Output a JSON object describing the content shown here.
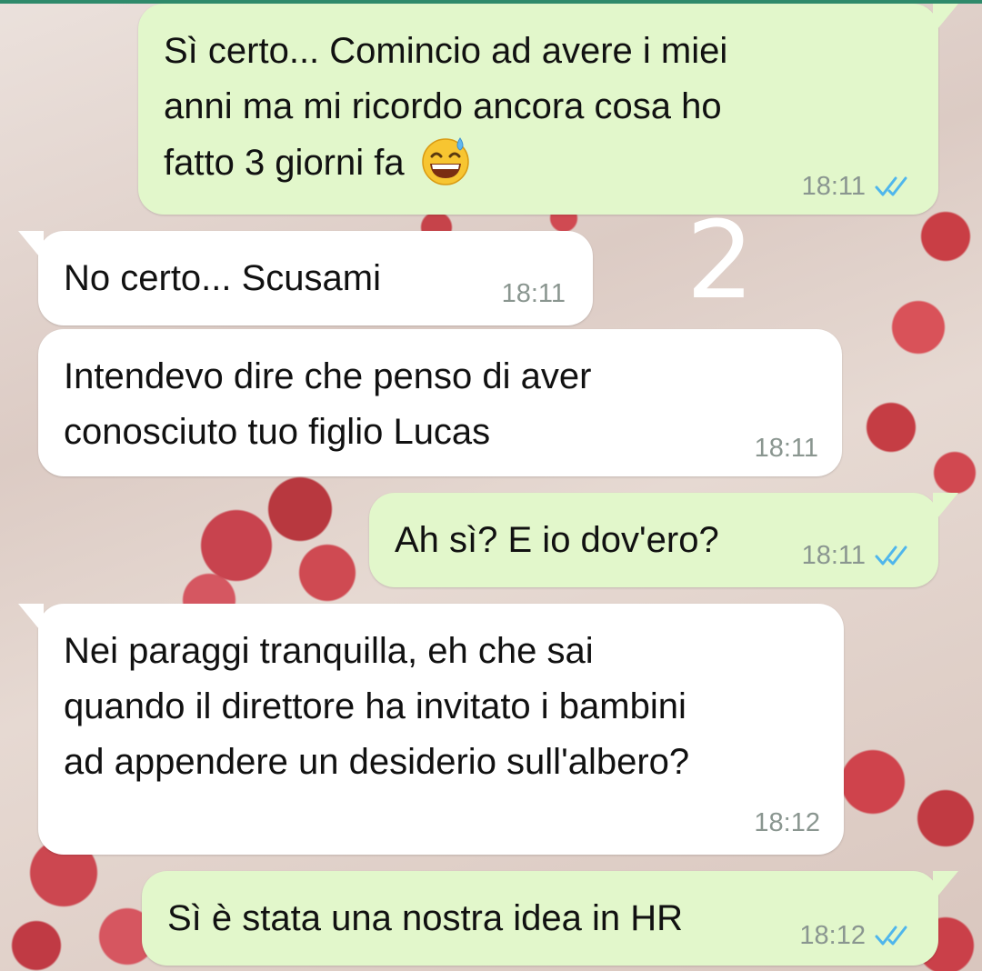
{
  "handwritten_mark": "2",
  "messages": [
    {
      "direction": "outgoing",
      "lines": [
        "Sì certo... Comincio ad avere i miei",
        "anni ma mi ricordo ancora cosa ho",
        "fatto 3 giorni fa"
      ],
      "emoji": "grinning-face-with-sweat-icon",
      "time": "18:11",
      "status": "read"
    },
    {
      "direction": "incoming",
      "lines": [
        "No certo... Scusami"
      ],
      "time": "18:11"
    },
    {
      "direction": "incoming",
      "lines": [
        "Intendevo dire che penso di aver",
        "conosciuto tuo figlio Lucas"
      ],
      "time": "18:11"
    },
    {
      "direction": "outgoing",
      "lines": [
        "Ah sì? E io dov'ero?"
      ],
      "time": "18:11",
      "status": "read"
    },
    {
      "direction": "incoming",
      "lines": [
        "Nei paraggi tranquilla, eh che sai",
        "quando il direttore ha invitato i bambini",
        "ad appendere un desiderio sull'albero?"
      ],
      "time": "18:12"
    },
    {
      "direction": "outgoing",
      "lines": [
        "Sì è stata una nostra idea in HR"
      ],
      "time": "18:12",
      "status": "read"
    }
  ],
  "colors": {
    "outgoing_bubble": "#e2f7cb",
    "incoming_bubble": "#ffffff",
    "read_ticks": "#4fb6ec",
    "timestamp": "#8a9690",
    "top_bar": "#2f8a6b"
  }
}
